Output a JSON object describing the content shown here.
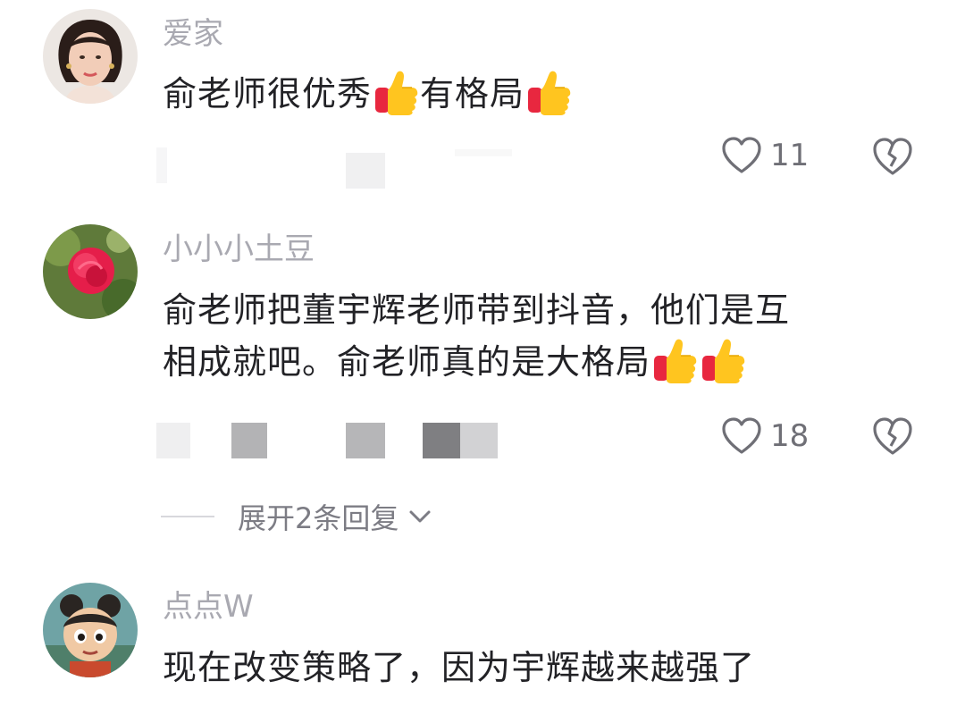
{
  "comments": [
    {
      "username": "爱家",
      "text": "俞老师很优秀",
      "text_after": "有格局",
      "likes": "11"
    },
    {
      "username": "小小小土豆",
      "text_line1": "俞老师把董宇辉老师带到抖音，他们是互",
      "text_line2": "相成就吧。俞老师真的是大格局",
      "likes": "18"
    },
    {
      "username": "点点W",
      "text": "现在改变策略了，因为宇辉越来越强了"
    }
  ],
  "expand_replies": "展开2条回复",
  "icons": {
    "like": "heart-outline-icon",
    "dislike": "broken-heart-icon",
    "emoji": "thumbs-up-emoji-icon",
    "expand": "chevron-down-icon"
  },
  "colors": {
    "username": "#a9a9b1",
    "text": "#222226",
    "meta": "#6f6f76"
  }
}
